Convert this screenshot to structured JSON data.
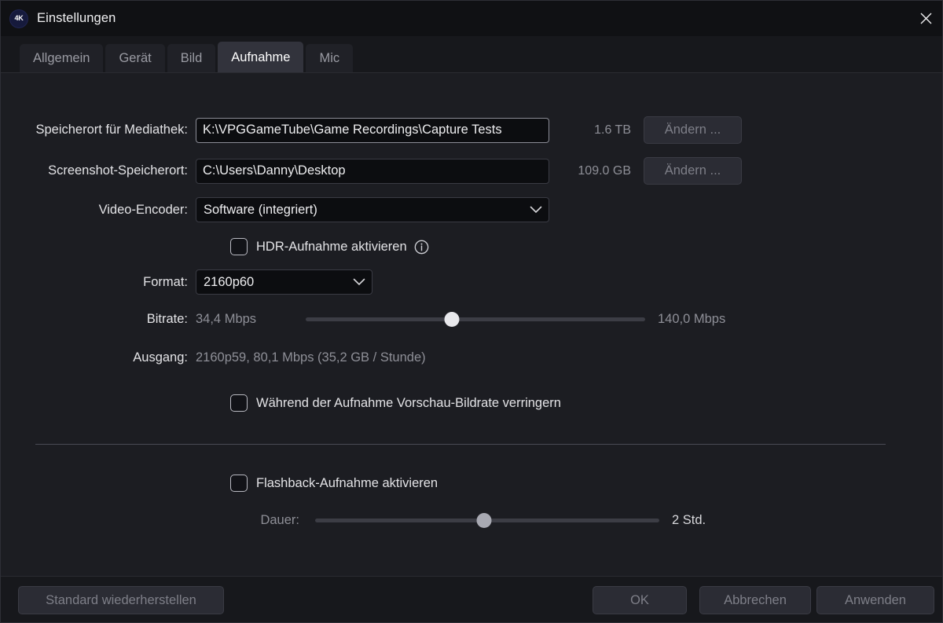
{
  "window": {
    "title": "Einstellungen",
    "logo_text": "4K",
    "logo_icon": "4k-logo-icon",
    "close_icon": "close-icon",
    "accent_bg": "#1c1d22",
    "titlebar_bg": "#101114"
  },
  "tabs": [
    {
      "label": "Allgemein",
      "active": false
    },
    {
      "label": "Gerät",
      "active": false
    },
    {
      "label": "Bild",
      "active": false
    },
    {
      "label": "Aufnahme",
      "active": true
    },
    {
      "label": "Mic",
      "active": false
    }
  ],
  "form": {
    "media_library": {
      "label": "Speicherort für Mediathek:",
      "value": "K:\\VPGGameTube\\Game Recordings\\Capture Tests",
      "free_space": "1.6 TB",
      "change_button": "Ändern ..."
    },
    "screenshot_location": {
      "label": "Screenshot-Speicherort:",
      "value": "C:\\Users\\Danny\\Desktop",
      "free_space": "109.0 GB",
      "change_button": "Ändern ..."
    },
    "video_encoder": {
      "label": "Video-Encoder:",
      "value": "Software (integriert)",
      "chevron_icon": "chevron-down-icon"
    },
    "hdr": {
      "label": "HDR-Aufnahme aktivieren",
      "checked": false,
      "info_icon": "info-icon"
    },
    "format": {
      "label": "Format:",
      "value": "2160p60",
      "chevron_icon": "chevron-down-icon"
    },
    "bitrate": {
      "label": "Bitrate:",
      "min_label": "34,4 Mbps",
      "max_label": "140,0 Mbps",
      "position_percent": 43
    },
    "output": {
      "label": "Ausgang:",
      "value": "2160p59, 80,1 Mbps (35,2 GB / Stunde)"
    },
    "reduce_preview": {
      "label": "Während der Aufnahme Vorschau-Bildrate verringern",
      "checked": false
    },
    "flashback": {
      "label": "Flashback-Aufnahme aktivieren",
      "checked": false
    },
    "duration": {
      "label": "Dauer:",
      "value_label": "2 Std.",
      "position_percent": 49
    }
  },
  "footer": {
    "restore_defaults": "Standard wiederherstellen",
    "ok": "OK",
    "cancel": "Abbrechen",
    "apply": "Anwenden"
  }
}
